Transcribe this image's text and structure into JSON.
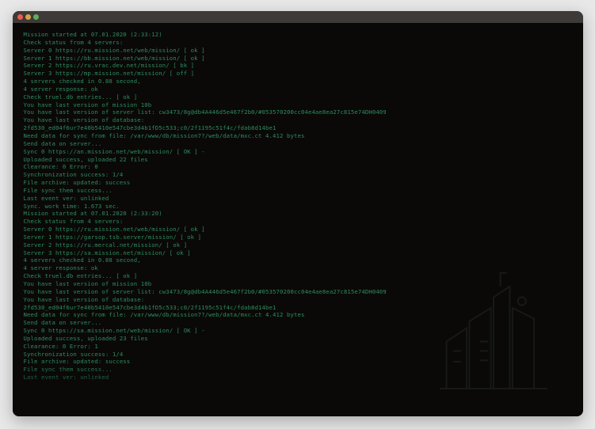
{
  "colors": {
    "window_bg": "#0a0908",
    "titlebar": "#3d3a38",
    "term_text": "#2e8c5d"
  },
  "title_buttons": {
    "close": "close",
    "min": "minimize",
    "max": "maximize"
  },
  "terminal": {
    "lines": [
      "Mission started at 07.01.2020 (2:33:12)",
      "Check status from 4 servers:",
      "Server 0 https://ru.mission.net/web/mission/ [ ok ]",
      "Server 1 https://bb.mission.net/web/mission/ [ ok ]",
      "Server 2 https://ru.vrac.dev.net/mission/ [ bk ]",
      "Server 3 https://mp.mission.net/mission/ [ off ]",
      "4 servers checked in 0.88 second,",
      "4 server response: ok",
      "",
      "Check truel.db entries... [ ok ]",
      "You have last version of mission 10b",
      "You have last version of server list: cw3473/8g@db4A446d5e467f2b0/#053570200cc04e4ae8ea27c815e74DH0409",
      "You have last version of database:",
      "2fd530_ed04f6ur7e40b5410e547cbe3d4b1fD5c533;c0/2f1195c51f4c/fdab8d14be1",
      "Need data for sync from file: /var/www/db/mission7?/web/data/mxc.ct 4.412 bytes",
      "Send data on server...",
      "Sync 0 https://an.mission.net/web/mission/ [ OK ] -",
      "Uploaded success, uploaded 22 files",
      "Clearance: 0 Error: 0",
      "Synchronization success: 1/4",
      "File archive: updated: success",
      "File sync them success...",
      "Last event ver: unlinked",
      "Sync. work time: 1.673 sec.",
      "Mission started at 07.01.2020 (2:33:20)",
      "",
      "Check status from 4 servers:",
      "Server 0 https://ru.mission.net/web/mission/ [ ok ]",
      "Server 1 https://garsop.tsb.server/mission/ [ ok ]",
      "Server 2 https://ru.mercal.net/mission/ [ ok ]",
      "Server 3 https://sa.mission.net/mission/ [ ok ]",
      "4 servers checked in 0.88 second,",
      "4 server response: ok",
      "",
      "Check truel.db entries... [ ok ]",
      "You have last version of mission 10b",
      "You have last version of server list: cw3473/8g@db4A446d5e467f2b0/#053570200cc04e4ae8ea27c815e74DH0409",
      "You have last version of database:",
      "2fd530_ed04f6ur7e40b5410e547cbe3d4b1fD5c533;c0/2f1195c51f4c/fdab8d14be1",
      "Need data for sync from file: /var/www/db/mission7?/web/data/mxc.ct 4.412 bytes",
      "Send data on server...",
      "Sync 0 https://sa.mission.net/web/mission/ [ OK ] -",
      "Uploaded success, uploaded 23 files",
      "Clearance: 0 Error: 1",
      "Synchronization success: 1/4",
      "File archive: updated: success",
      "File sync them success...",
      "Last event ver: unlinked"
    ]
  }
}
